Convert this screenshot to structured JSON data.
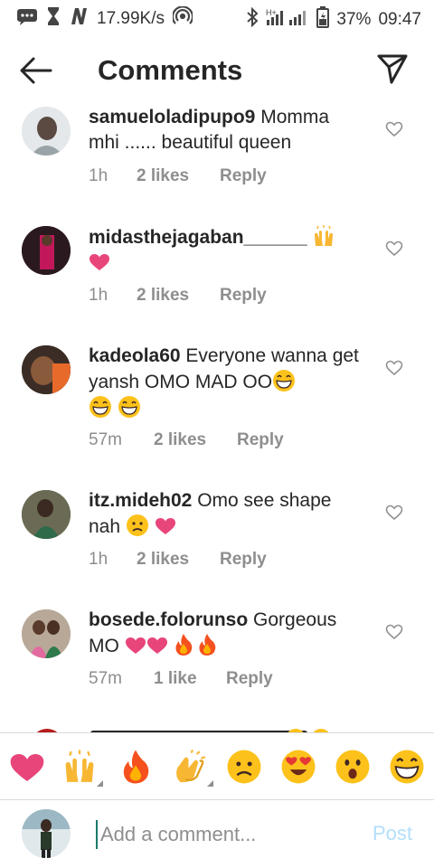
{
  "status_bar": {
    "speed": "17.99K/s",
    "battery": "37%",
    "time": "09:47",
    "icons": [
      "message-icon",
      "hourglass-icon",
      "n-icon",
      "hotspot-icon",
      "bluetooth-icon",
      "signal-icon",
      "battery-icon"
    ]
  },
  "header": {
    "title": "Comments",
    "back_icon": "arrow-left-icon",
    "send_icon": "paper-plane-icon"
  },
  "comments": [
    {
      "username": "samueloladipupo9",
      "text": "Momma mhi ...... beautiful queen",
      "time": "1h",
      "likes": "2 likes",
      "reply": "Reply"
    },
    {
      "username": "midasthejagaban______",
      "text": "",
      "time": "1h",
      "likes": "2 likes",
      "reply": "Reply"
    },
    {
      "username": "kadeola60",
      "text": "Everyone wanna get yansh OMO MAD OO",
      "time": "57m",
      "likes": "2 likes",
      "reply": "Reply"
    },
    {
      "username": "itz.mideh02",
      "text": "Omo see shape nah",
      "time": "1h",
      "likes": "2 likes",
      "reply": "Reply"
    },
    {
      "username": "bosede.folorunso",
      "text": "Gorgeous MO",
      "time": "57m",
      "likes": "1 like",
      "reply": "Reply"
    }
  ],
  "emoji_bar": [
    "heart",
    "raised-hands",
    "fire",
    "clapping-hands",
    "sad-face",
    "heart-eyes",
    "surprised-face",
    "grinning-face"
  ],
  "input": {
    "placeholder": "Add a comment...",
    "post_label": "Post"
  },
  "colors": {
    "text": "#262626",
    "meta": "#8e8e8e",
    "heart_pink": "#e8457a",
    "post_disabled": "#b2dffc",
    "divider": "#dbdbdb"
  }
}
